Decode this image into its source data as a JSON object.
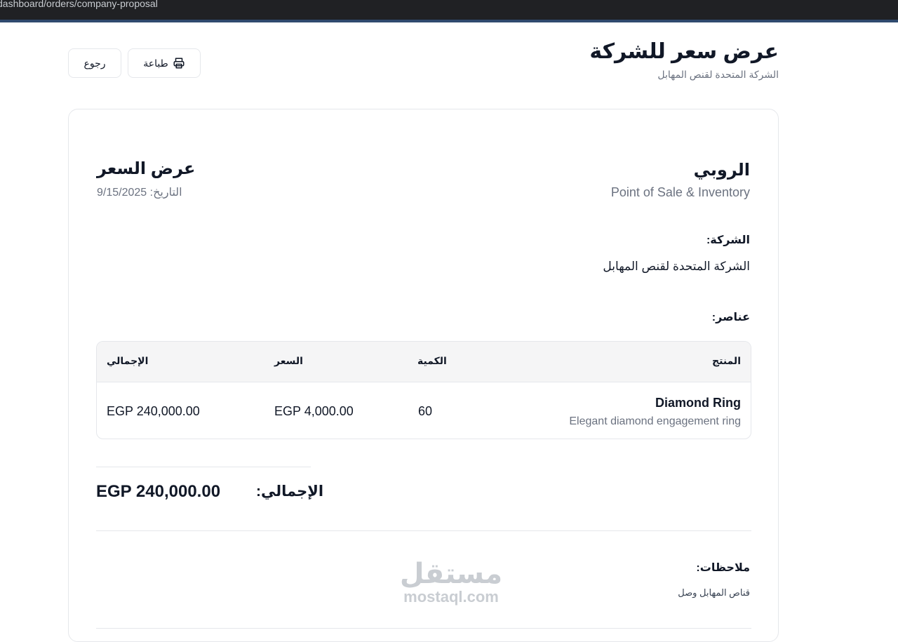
{
  "browser": {
    "url": "dashboard/orders/company-proposal"
  },
  "header": {
    "title": "عرض سعر للشركة",
    "subtitle": "الشركة المتحدة لقنص المهابل",
    "print_label": "طباعة",
    "back_label": "رجوع"
  },
  "quote": {
    "brand_name": "الروبي",
    "brand_tagline": "Point of Sale & Inventory",
    "title": "عرض السعر",
    "date_label": "التاريخ:",
    "date_value": "9/15/2025",
    "company_label": "الشركة:",
    "company_name": "الشركة المتحدة لقنص المهابل",
    "items_label": "عناصر:",
    "table": {
      "headers": [
        "المنتج",
        "الكمية",
        "السعر",
        "الإجمالي"
      ],
      "rows": [
        {
          "product": "Diamond Ring",
          "description": "Elegant diamond engagement ring",
          "quantity": "60",
          "price": "EGP 4,000.00",
          "total": "EGP 240,000.00"
        }
      ]
    },
    "total_label": "الإجمالي:",
    "total_value": "EGP 240,000.00",
    "notes_label": "ملاحظات:",
    "notes_text": "قناص المهابل وصل"
  },
  "watermark": {
    "arabic": "مستقل",
    "latin": "mostaql.com"
  },
  "colors": {
    "url_bar": "#202124",
    "accent_strip": "#2f4a6e",
    "border": "#e5e7eb",
    "muted_text": "#6b7280"
  }
}
